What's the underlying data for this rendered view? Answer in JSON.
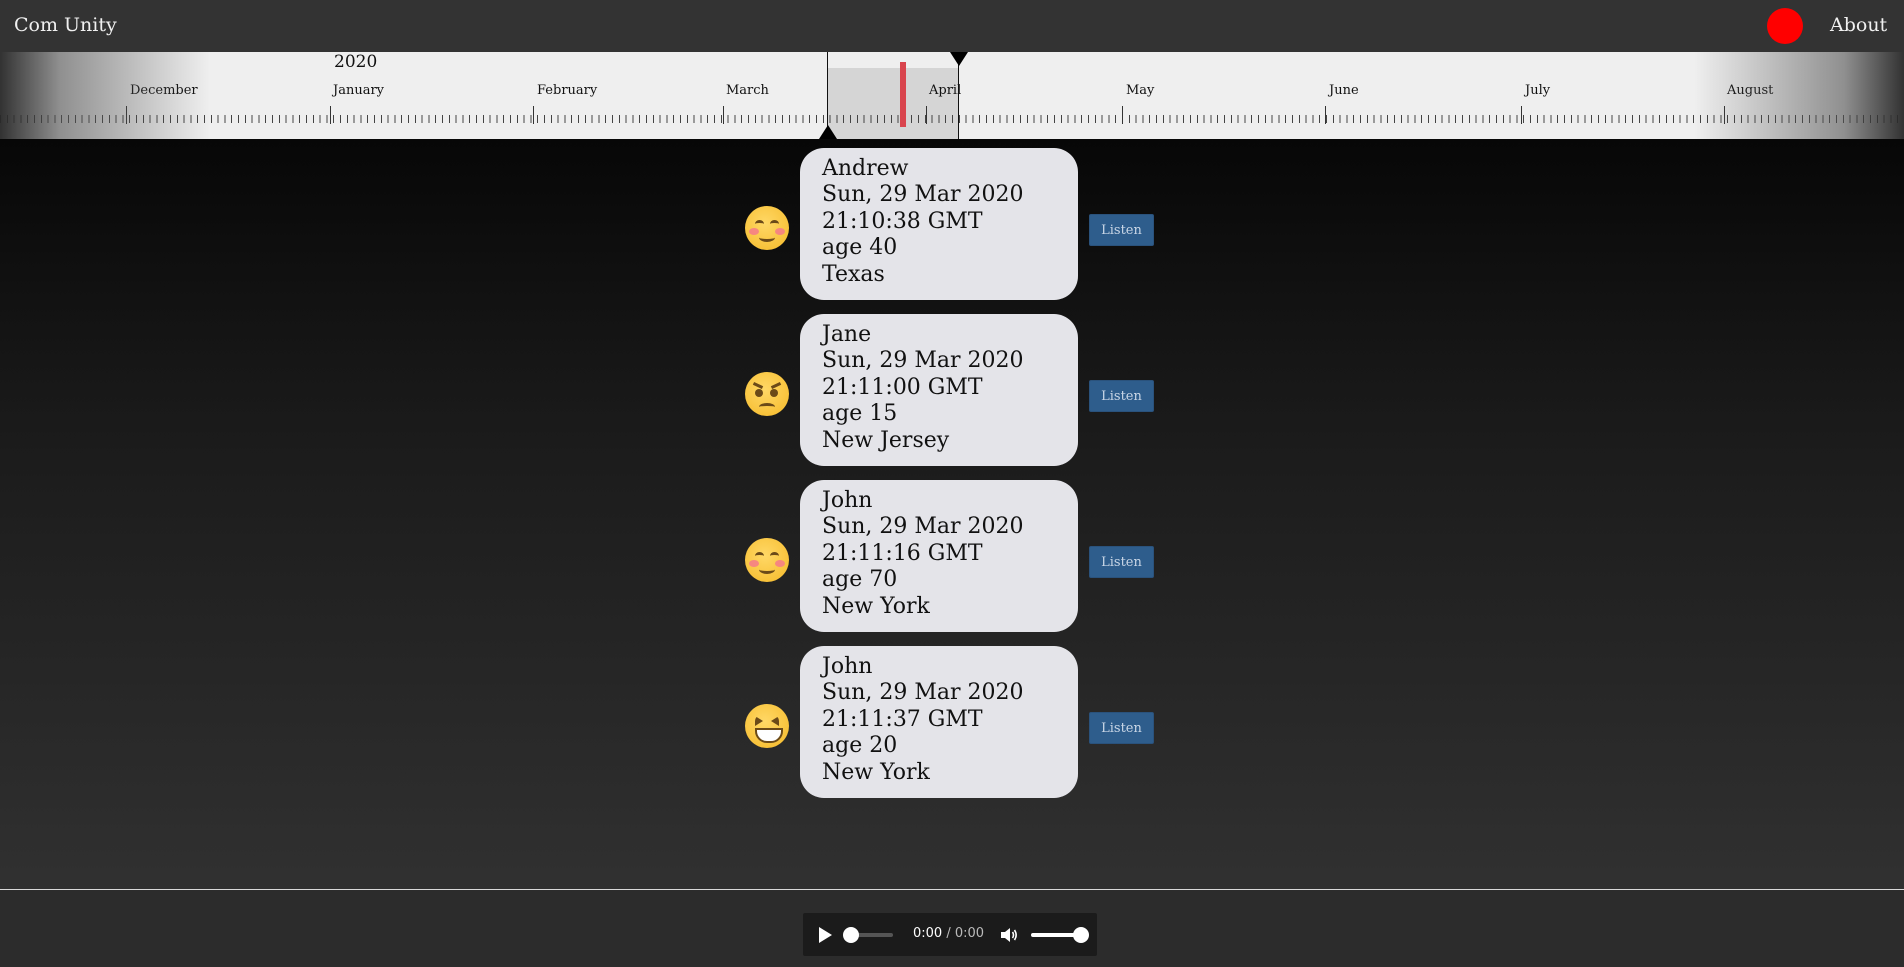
{
  "header": {
    "brand": "Com Unity",
    "record_color": "#ff0000",
    "about_label": "About"
  },
  "timeline": {
    "year_label": "2020",
    "months": [
      "December",
      "January",
      "February",
      "March",
      "April",
      "May",
      "June",
      "July",
      "August"
    ],
    "marker_color": "#d9444d"
  },
  "messages": [
    {
      "name": "Andrew",
      "date": "Sun, 29 Mar 2020",
      "time": "21:10:38 GMT",
      "age": "age 40",
      "location": "Texas",
      "emoji": "smiling-blush-emoji",
      "listen_label": "Listen"
    },
    {
      "name": "Jane",
      "date": "Sun, 29 Mar 2020",
      "time": "21:11:00 GMT",
      "age": "age 15",
      "location": "New Jersey",
      "emoji": "angry-face-emoji",
      "listen_label": "Listen"
    },
    {
      "name": "John",
      "date": "Sun, 29 Mar 2020",
      "time": "21:11:16 GMT",
      "age": "age 70",
      "location": "New York",
      "emoji": "smiling-blush-emoji",
      "listen_label": "Listen"
    },
    {
      "name": "John",
      "date": "Sun, 29 Mar 2020",
      "time": "21:11:37 GMT",
      "age": "age 20",
      "location": "New York",
      "emoji": "laughing-squint-emoji",
      "listen_label": "Listen"
    }
  ],
  "player": {
    "current_time": "0:00",
    "separator": " / ",
    "duration": "0:00",
    "progress": 0,
    "volume": 1
  }
}
